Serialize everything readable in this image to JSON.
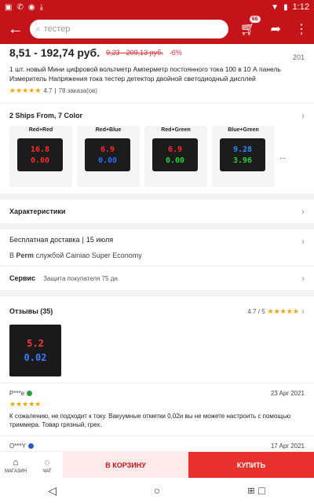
{
  "status_bar": {
    "time": "1:12",
    "left_icons": [
      "notification-icon",
      "phone-icon",
      "whatsapp-icon",
      "download-icon"
    ],
    "right_icons": [
      "wifi-icon",
      "battery-icon"
    ]
  },
  "app_bar": {
    "back_icon": "back-arrow-icon",
    "search_placeholder": "тестер",
    "cart_badge": "66",
    "share_icon": "share-icon",
    "more_icon": "more-vert-icon"
  },
  "product": {
    "price": "8,51 - 192,74 руб.",
    "old_price": "9,23 - 209,13 руб.",
    "discount": "-6%",
    "count_right": "201",
    "title": "1 шт. новый Мини цифровой вольтметр Амперметр постоянного тока 100 в 10 А панель Измеритель Напряжения тока тестер детектор двойной светодиодный дисплей",
    "rating": "4.7",
    "orders": "78 заказа(ов)"
  },
  "variants": {
    "header": "2 Ships From, 7 Color",
    "more": "...",
    "items": [
      {
        "label": "Red+Red",
        "top": "16.8",
        "bottom": "0.00",
        "top_color": "#ff2a2a",
        "bottom_color": "#ff2a2a"
      },
      {
        "label": "Red+Blue",
        "top": "6.9",
        "bottom": "0.00",
        "top_color": "#ff2a2a",
        "bottom_color": "#2a6bff"
      },
      {
        "label": "Red+Green",
        "top": "6.9",
        "bottom": "0.00",
        "top_color": "#ff2a2a",
        "bottom_color": "#22d13a"
      },
      {
        "label": "Blue+Green",
        "top": "9.28",
        "bottom": "3.96",
        "top_color": "#2a8bff",
        "bottom_color": "#22d13a"
      }
    ]
  },
  "characteristics": {
    "label": "Характеристики"
  },
  "delivery": {
    "free": "Бесплатная доставка",
    "date": "15 июля",
    "prefix": "В",
    "city": "Perm",
    "service": "службой Cainiao Super Economy"
  },
  "service": {
    "label": "Сервис",
    "text": "Защита покупателя 75 дн."
  },
  "reviews": {
    "header": "Отзывы (35)",
    "score": "4.7 / 5",
    "photo_top": "5.2",
    "photo_bottom": "0.02",
    "items": [
      {
        "name": "P***e",
        "date": "23 Apr 2021",
        "text": "К сожалению, не подходит к току. Вакуумные отметки 0,02и вы не можете настроить с помощью триммера. Товар грязный, грех."
      },
      {
        "name": "O***Y",
        "date": "17 Apr 2021"
      }
    ]
  },
  "bottom_bar": {
    "store_label": "МАГАЗИН",
    "chat_label": "ЧАТ",
    "cart_button": "В КОРЗИНУ",
    "buy_button": "КУПИТЬ"
  },
  "colors": {
    "brand": "#c4141a",
    "buy": "#e8312d",
    "star": "#f0a500"
  }
}
